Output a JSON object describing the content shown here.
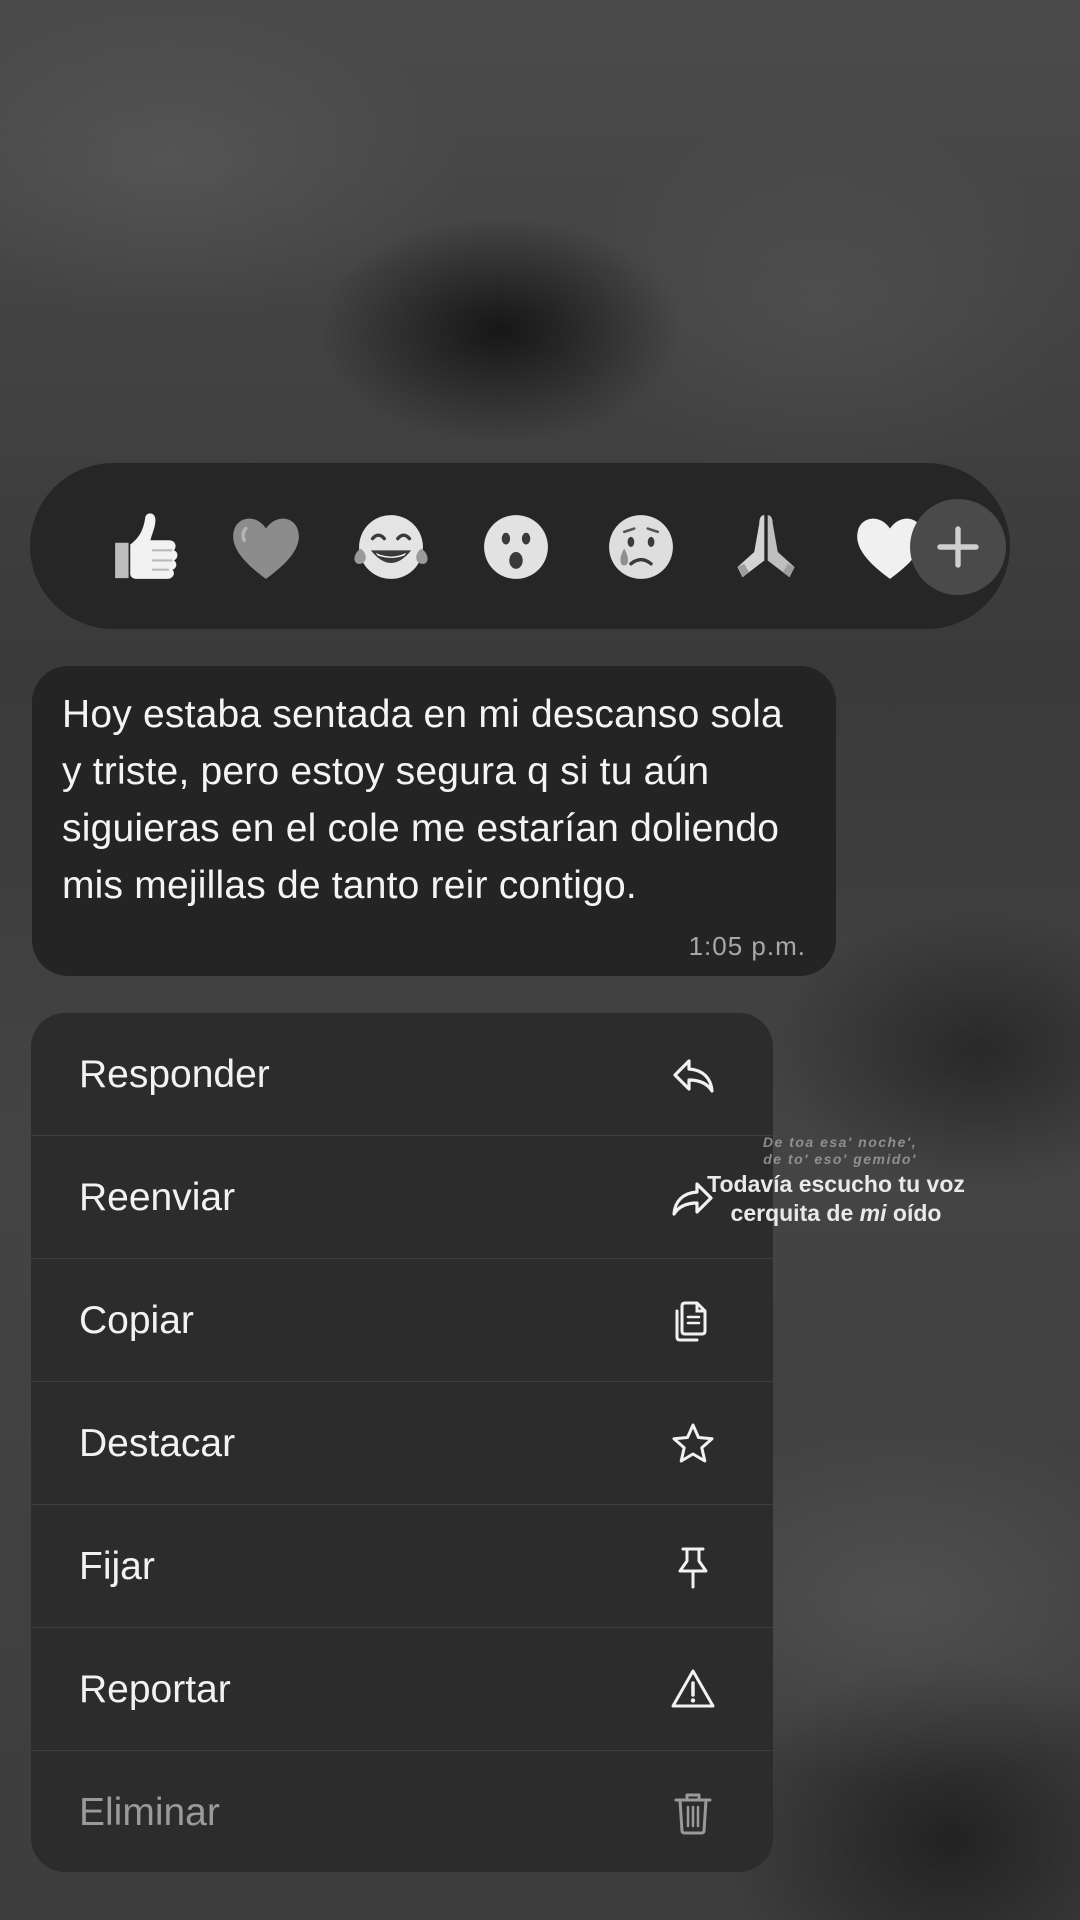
{
  "reactions": [
    {
      "name": "thumbs-up",
      "color": "#e6e6e6"
    },
    {
      "name": "heart",
      "color": "#8c8c8c"
    },
    {
      "name": "tears-of-joy",
      "color": "#e0e0e0"
    },
    {
      "name": "surprised-face",
      "color": "#e0e0e0"
    },
    {
      "name": "crying-face",
      "color": "#dcdcdc"
    },
    {
      "name": "praying-hands",
      "color": "#cfcfcf"
    },
    {
      "name": "white-heart",
      "color": "#f0f0f0"
    }
  ],
  "add_reaction_icon": "plus-icon",
  "message": {
    "text": "Hoy estaba sentada en mi descanso sola y triste, pero estoy segura q si tu aún siguieras en el cole me estarían doliendo mis mejillas de tanto reir contigo.",
    "time": "1:05 p.m."
  },
  "menu": {
    "items": [
      {
        "label": "Responder",
        "icon": "reply-icon"
      },
      {
        "label": "Reenviar",
        "icon": "forward-icon"
      },
      {
        "label": "Copiar",
        "icon": "copy-icon"
      },
      {
        "label": "Destacar",
        "icon": "star-icon"
      },
      {
        "label": "Fijar",
        "icon": "pin-icon"
      },
      {
        "label": "Reportar",
        "icon": "warning-icon"
      },
      {
        "label": "Eliminar",
        "icon": "trash-icon"
      }
    ]
  },
  "overlay": {
    "small_line1": "De toa esa' noche',",
    "small_line2": "de to' eso' gemido'",
    "main_prefix": "Todavía escucho tu voz cerquita de ",
    "main_italic": "mi",
    "main_suffix": " oído"
  },
  "colors": {
    "panel": "#2c2c2c",
    "bubble": "#242424",
    "reaction_bar": "#262626",
    "text": "#f2f2f2",
    "destructive_text": "#9a9a9a"
  }
}
